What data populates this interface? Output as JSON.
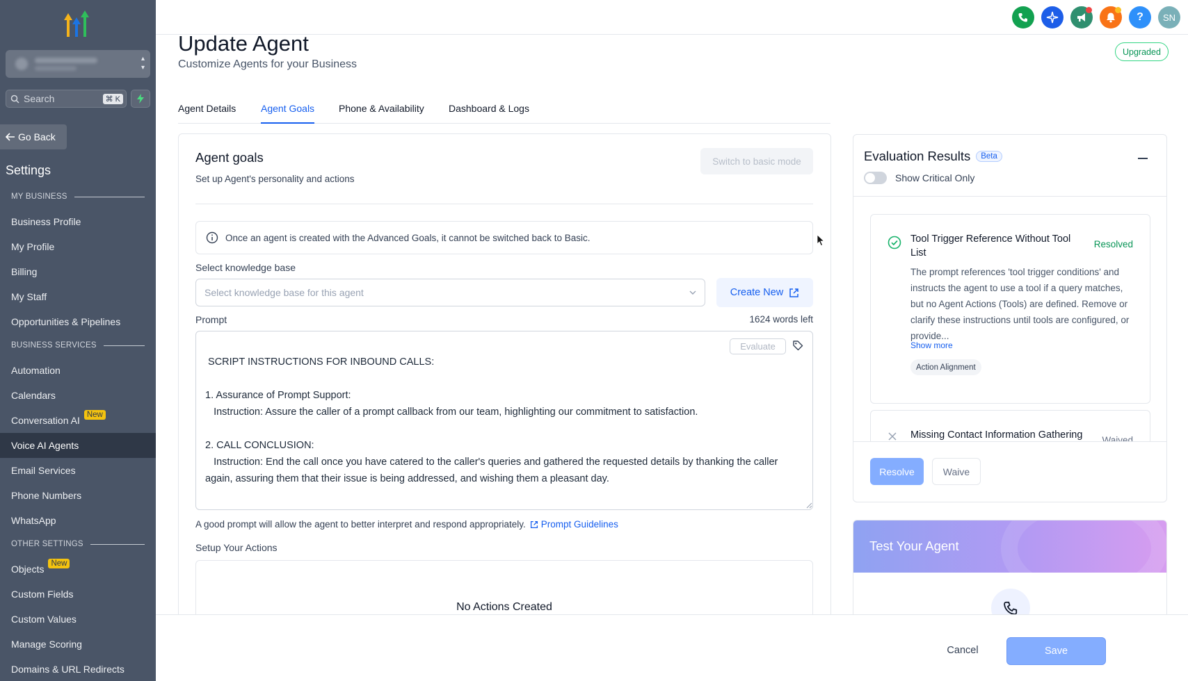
{
  "sidebar": {
    "search_placeholder": "Search",
    "search_shortcut": "⌘ K",
    "go_back": "Go Back",
    "settings_title": "Settings",
    "sections": {
      "my_business": "MY BUSINESS",
      "business_services": "BUSINESS SERVICES",
      "other_settings": "OTHER SETTINGS"
    },
    "items": [
      {
        "label": "Business Profile"
      },
      {
        "label": "My Profile"
      },
      {
        "label": "Billing"
      },
      {
        "label": "My Staff"
      },
      {
        "label": "Opportunities & Pipelines"
      },
      {
        "label": "Automation"
      },
      {
        "label": "Calendars"
      },
      {
        "label": "Conversation AI",
        "badge": "New"
      },
      {
        "label": "Voice AI Agents",
        "active": true
      },
      {
        "label": "Email Services"
      },
      {
        "label": "Phone Numbers"
      },
      {
        "label": "WhatsApp"
      },
      {
        "label": "Objects",
        "badge": "New"
      },
      {
        "label": "Custom Fields"
      },
      {
        "label": "Custom Values"
      },
      {
        "label": "Manage Scoring"
      },
      {
        "label": "Domains & URL Redirects"
      }
    ]
  },
  "topbar": {
    "icons": [
      {
        "name": "phone-icon",
        "color": "#12a150"
      },
      {
        "name": "sparkle-icon",
        "color": "#1d5ee8"
      },
      {
        "name": "megaphone-icon",
        "color": "#2f8f6f"
      },
      {
        "name": "bell-icon",
        "color": "#f97316"
      },
      {
        "name": "help-icon",
        "color": "#2e90fa"
      }
    ],
    "avatar_initials": "SN"
  },
  "header": {
    "title": "Update Agent",
    "subtitle": "Customize Agents for your Business",
    "status_badge": "Upgraded"
  },
  "tabs": [
    {
      "label": "Agent Details"
    },
    {
      "label": "Agent Goals",
      "active": true
    },
    {
      "label": "Phone & Availability"
    },
    {
      "label": "Dashboard & Logs"
    }
  ],
  "goals": {
    "title": "Agent goals",
    "subtitle": "Set up Agent's personality and actions",
    "switch_basic_label": "Switch to basic mode",
    "info_text": "Once an agent is created with the Advanced Goals, it cannot be switched back to Basic.",
    "knowledge_label": "Select knowledge base",
    "knowledge_placeholder": "Select knowledge base for this agent",
    "create_new_label": "Create New",
    "prompt_label": "Prompt",
    "words_left": "1624 words left",
    "evaluate_label": "Evaluate",
    "prompt_text": " SCRIPT INSTRUCTIONS FOR INBOUND CALLS:\n\n1. Assurance of Prompt Support:\n   Instruction: Assure the caller of a prompt callback from our team, highlighting our commitment to satisfaction.\n\n2. CALL CONCLUSION:\n   Instruction: End the call once you have catered to the caller's queries and gathered the requested details by thanking the caller again, assuring them that their issue is being addressed, and wishing them a pleasant day.",
    "hint_text": "A good prompt will allow the agent to better interpret and respond appropriately.",
    "guidelines_link": "Prompt Guidelines",
    "actions_label": "Setup Your Actions",
    "no_actions": "No Actions Created"
  },
  "evaluation": {
    "title": "Evaluation Results",
    "beta_badge": "Beta",
    "toggle_label": "Show Critical Only",
    "results": [
      {
        "title": "Tool Trigger Reference Without Tool List",
        "status": "Resolved",
        "description": "The prompt references 'tool trigger conditions' and instructs the agent to use a tool if a query matches, but no Agent Actions (Tools) are defined. Remove or clarify these instructions until tools are configured, or provide...",
        "show_more": "Show more",
        "chip": "Action Alignment"
      },
      {
        "title": "Missing Contact Information Gathering",
        "status": "Waived"
      }
    ],
    "resolve_label": "Resolve",
    "waive_label": "Waive"
  },
  "test_agent": {
    "title": "Test Your Agent"
  },
  "footer": {
    "cancel_label": "Cancel",
    "save_label": "Save"
  }
}
